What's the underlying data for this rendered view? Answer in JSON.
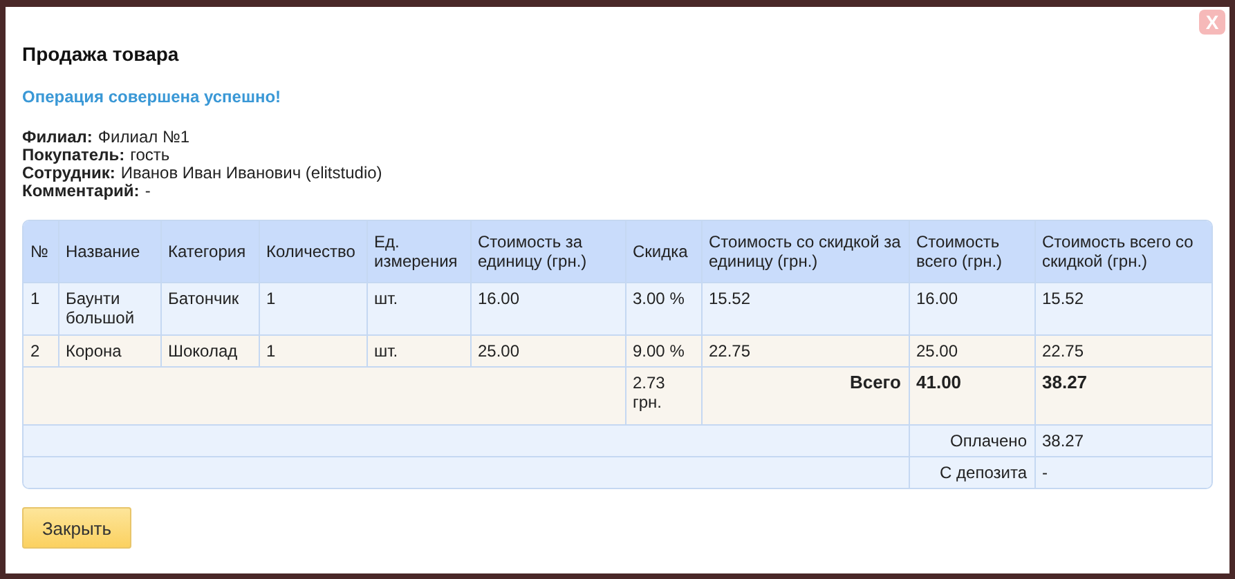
{
  "dialog": {
    "title": "Продажа товара",
    "close_icon": "X"
  },
  "message": "Операция совершена успешно!",
  "info": [
    {
      "label": "Филиал:",
      "value": "Филиал №1"
    },
    {
      "label": "Покупатель:",
      "value": "гость"
    },
    {
      "label": "Сотрудник:",
      "value": "Иванов Иван Иванович (elitstudio)"
    },
    {
      "label": "Комментарий:",
      "value": "-"
    }
  ],
  "table": {
    "columns": [
      "№",
      "Название",
      "Категория",
      "Количество",
      "Ед. измерения",
      "Стоимость за единицу (грн.)",
      "Скидка",
      "Стоимость со скидкой за единицу (грн.)",
      "Стоимость всего (грн.)",
      "Стоимость всего со скидкой (грн.)"
    ],
    "rows": [
      [
        "1",
        "Баунти большой",
        "Батончик",
        "1",
        "шт.",
        "16.00",
        "3.00 %",
        "15.52",
        "16.00",
        "15.52"
      ],
      [
        "2",
        "Корона",
        "Шоколад",
        "1",
        "шт.",
        "25.00",
        "9.00 %",
        "22.75",
        "25.00",
        "22.75"
      ]
    ],
    "totals": {
      "discount": "2.73 грн.",
      "label": "Всего",
      "total": "41.00",
      "total_discounted": "38.27"
    },
    "summary": [
      {
        "label": "Оплачено",
        "value": "38.27"
      },
      {
        "label": "С депозита",
        "value": "-"
      }
    ]
  },
  "close_button": "Закрыть"
}
